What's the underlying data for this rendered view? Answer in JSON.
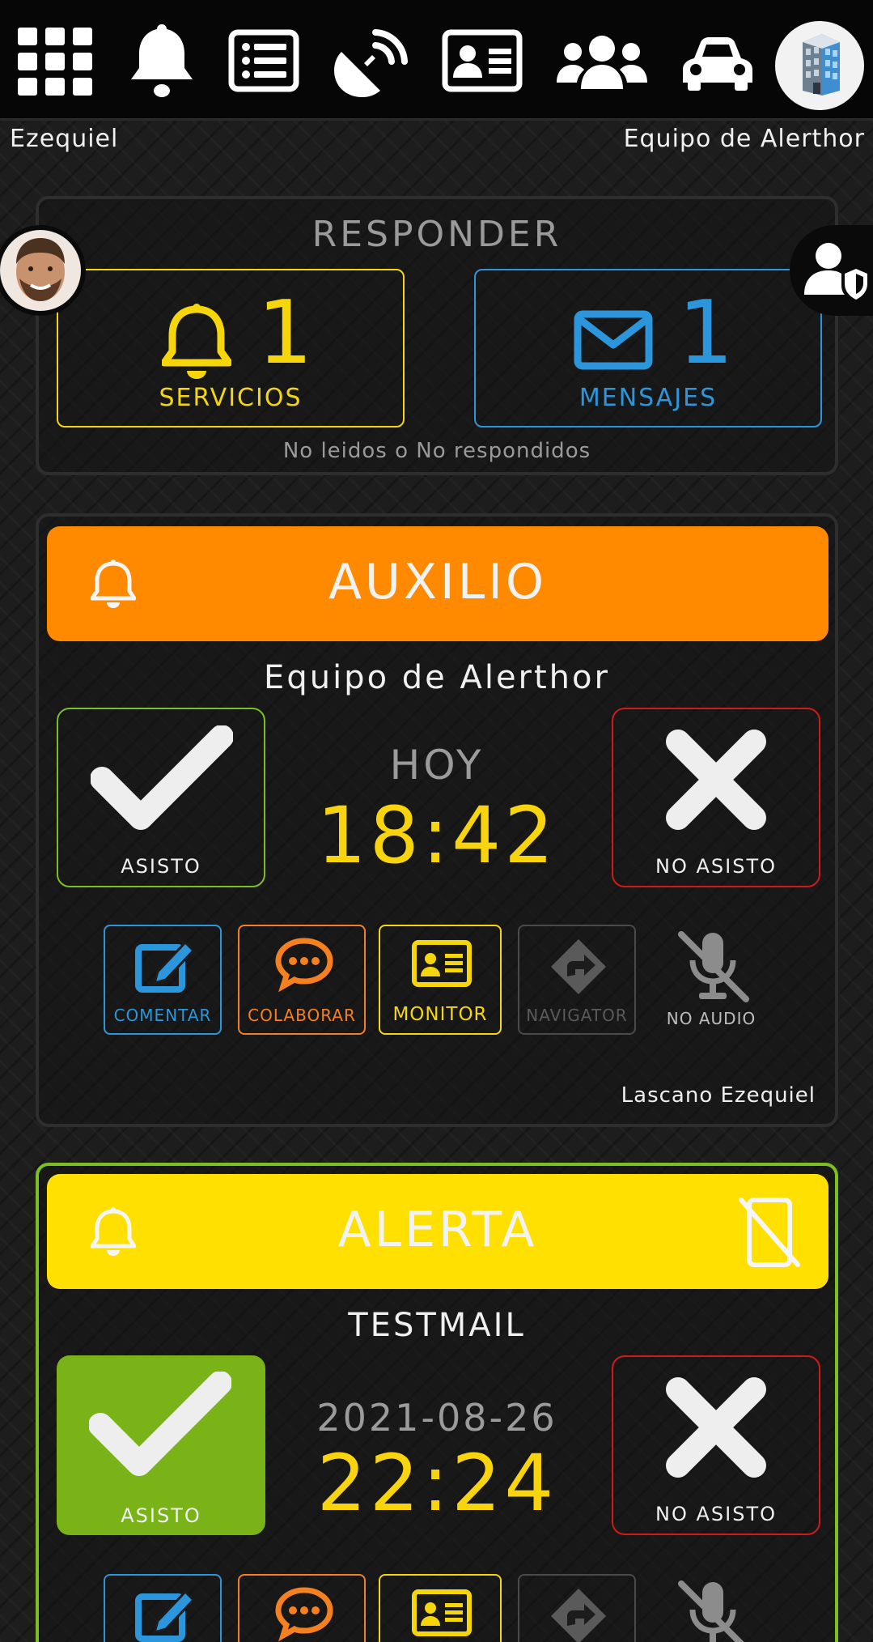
{
  "header": {
    "user_name": "Ezequiel",
    "team_name": "Equipo de Alerthor",
    "nav_icons": [
      "apps-grid-icon",
      "bell-icon",
      "list-icon",
      "satellite-dish-icon",
      "id-card-icon",
      "users-icon",
      "car-icon",
      "building-icon"
    ]
  },
  "responder": {
    "title": "RESPONDER",
    "servicios": {
      "count": "1",
      "label": "SERVICIOS",
      "color": "#f5d60c"
    },
    "mensajes": {
      "count": "1",
      "label": "MENSAJES",
      "color": "#2b96db"
    },
    "note": "No leidos o No respondidos"
  },
  "cards": [
    {
      "banner_title": "AUXILIO",
      "banner_color": "#ff8a00",
      "team": "Equipo de Alerthor",
      "accept_label": "ASISTO",
      "decline_label": "NO ASISTO",
      "when_label": "HOY",
      "when_time": "18:42",
      "actions": [
        "COMENTAR",
        "COLABORAR",
        "MONITOR",
        "NAVIGATOR",
        "NO AUDIO"
      ],
      "author": "Lascano Ezequiel"
    },
    {
      "banner_title": "ALERTA",
      "banner_color": "#ffe000",
      "team": "TESTMAIL",
      "accept_label": "ASISTO",
      "decline_label": "NO ASISTO",
      "when_label": "2021-08-26",
      "when_time": "22:24",
      "accepted_color": "#7ab317"
    }
  ],
  "colors": {
    "comentar": "#2b96db",
    "colaborar": "#f5801f",
    "monitor": "#f5d60c",
    "navigator": "#5a5a5a",
    "accept_border": "#7cbf1f",
    "decline_border": "#d11a1a"
  }
}
